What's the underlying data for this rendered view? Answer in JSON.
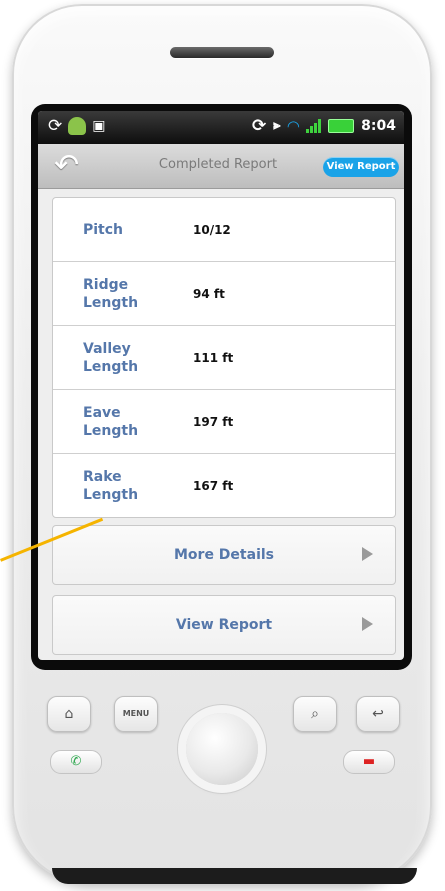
{
  "status_bar": {
    "icons": [
      "sync-icon",
      "android-icon",
      "usb-icon",
      "sync-icon",
      "vibrate-icon",
      "wifi-icon",
      "signal-icon",
      "battery-icon"
    ],
    "time": "8:04"
  },
  "title_bar": {
    "back_icon": "back-arrow-icon",
    "title": "Completed Report",
    "view_report_button": "View Report",
    "accent_color": "#1aa3e8"
  },
  "details": [
    {
      "label": "Pitch",
      "value": "10/12"
    },
    {
      "label": "Ridge Length",
      "value": "94 ft"
    },
    {
      "label": "Valley Length",
      "value": "111 ft"
    },
    {
      "label": "Eave Length",
      "value": "197 ft"
    },
    {
      "label": "Rake Length",
      "value": "167 ft"
    }
  ],
  "actions": {
    "more_details": "More Details",
    "view_report": "View Report"
  },
  "hardware_buttons": {
    "home": "home-icon",
    "menu": "MENU",
    "search": "search-icon",
    "back": "back-icon",
    "call": "call-icon",
    "end_call": "end-call-icon"
  },
  "callout_color": "#f5b400"
}
